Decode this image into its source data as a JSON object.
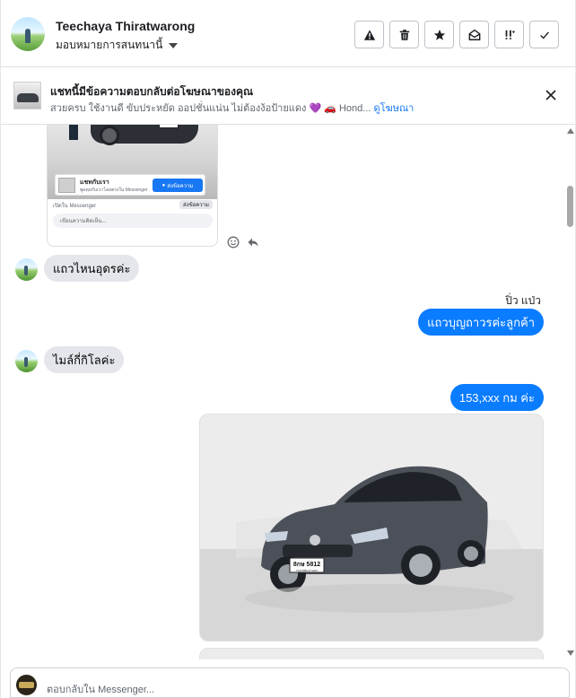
{
  "header": {
    "user_name": "Teechaya Thiratwarong",
    "assign_label": "มอบหมายการสนทนานี้",
    "actions": [
      {
        "icon": "warning-icon"
      },
      {
        "icon": "trash-icon"
      },
      {
        "icon": "star-icon"
      },
      {
        "icon": "mark-unread-icon"
      },
      {
        "icon": "follow-up-icon"
      },
      {
        "icon": "check-icon"
      }
    ]
  },
  "banner": {
    "title": "แชทนี้มีข้อความตอบกลับต่อโฆษณาของคุณ",
    "subtitle": "สวยครบ ใช้งานดี ขับประหยัด ออปชั่นแน่น ไม่ต้องง้อป้ายแดง 💜 🚗 Hond...",
    "link": "ดูโฆษณา"
  },
  "ad_card": {
    "cta_name": "แชทกับเรา",
    "cta_sub": "พูดคุยกับเราโดยตรงใน Messenger",
    "cta_button": "ส่งข้อความ",
    "open_in": "เปิดใน Messenger",
    "send_pill": "ส่งข้อความ",
    "comment_placeholder": "เขียนความคิดเห็น..."
  },
  "messages": [
    {
      "direction": "in",
      "text": "แถวไหนอุดรค่ะ"
    },
    {
      "direction": "out",
      "sender": "ปิ่ว แป่ว",
      "text": "แถวบุญถาวรค่ะลูกค้า"
    },
    {
      "direction": "in",
      "text": "ไมล์กี่กิโลค่ะ"
    },
    {
      "direction": "out",
      "text": "153,xxx  กม  ค่ะ"
    }
  ],
  "photo": {
    "plate_line1": "8กษ 5812",
    "plate_line2": "กรุงเทพมหานคร"
  },
  "composer": {
    "placeholder": "ตอบกลับใน Messenger..."
  },
  "colors": {
    "outgoing_bubble": "#0a7cff",
    "incoming_bubble": "#e4e6eb",
    "link": "#1877f2"
  }
}
